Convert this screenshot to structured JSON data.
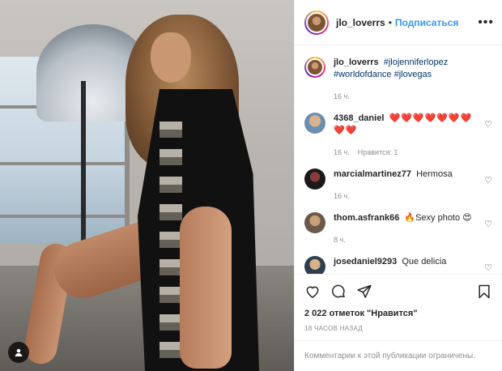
{
  "header": {
    "username": "jlo_loverrs",
    "separator": "•",
    "follow_label": "Подписаться",
    "more_icon": "more-horizontal-icon"
  },
  "caption": {
    "username": "jlo_loverrs",
    "text": "#jlojenniferlopez #worldofdance #jlovegas",
    "time": "16 ч."
  },
  "comments": [
    {
      "username": "4368_daniel",
      "text": "❤️❤️❤️❤️❤️❤️❤️❤️❤️",
      "time": "16 ч.",
      "likes": "Нравится: 1"
    },
    {
      "username": "marcialmartinez77",
      "text": "Hermosa",
      "time": "16 ч.",
      "likes": ""
    },
    {
      "username": "thom.asfrank66",
      "text": "🔥Sexy photo 😍",
      "time": "8 ч.",
      "likes": ""
    },
    {
      "username": "josedaniel9293",
      "text": "Que delicia",
      "time": "",
      "likes": ""
    }
  ],
  "actions": {
    "likes": "2 022 отметок \"Нравится\"",
    "timestamp": "18 ЧАСОВ НАЗАД",
    "comments_closed": "Комментарии к этой публикации ограничены."
  },
  "colors": {
    "link": "#3897f0",
    "hashtag": "#003569",
    "muted": "#8e8e8e",
    "text": "#262626"
  }
}
